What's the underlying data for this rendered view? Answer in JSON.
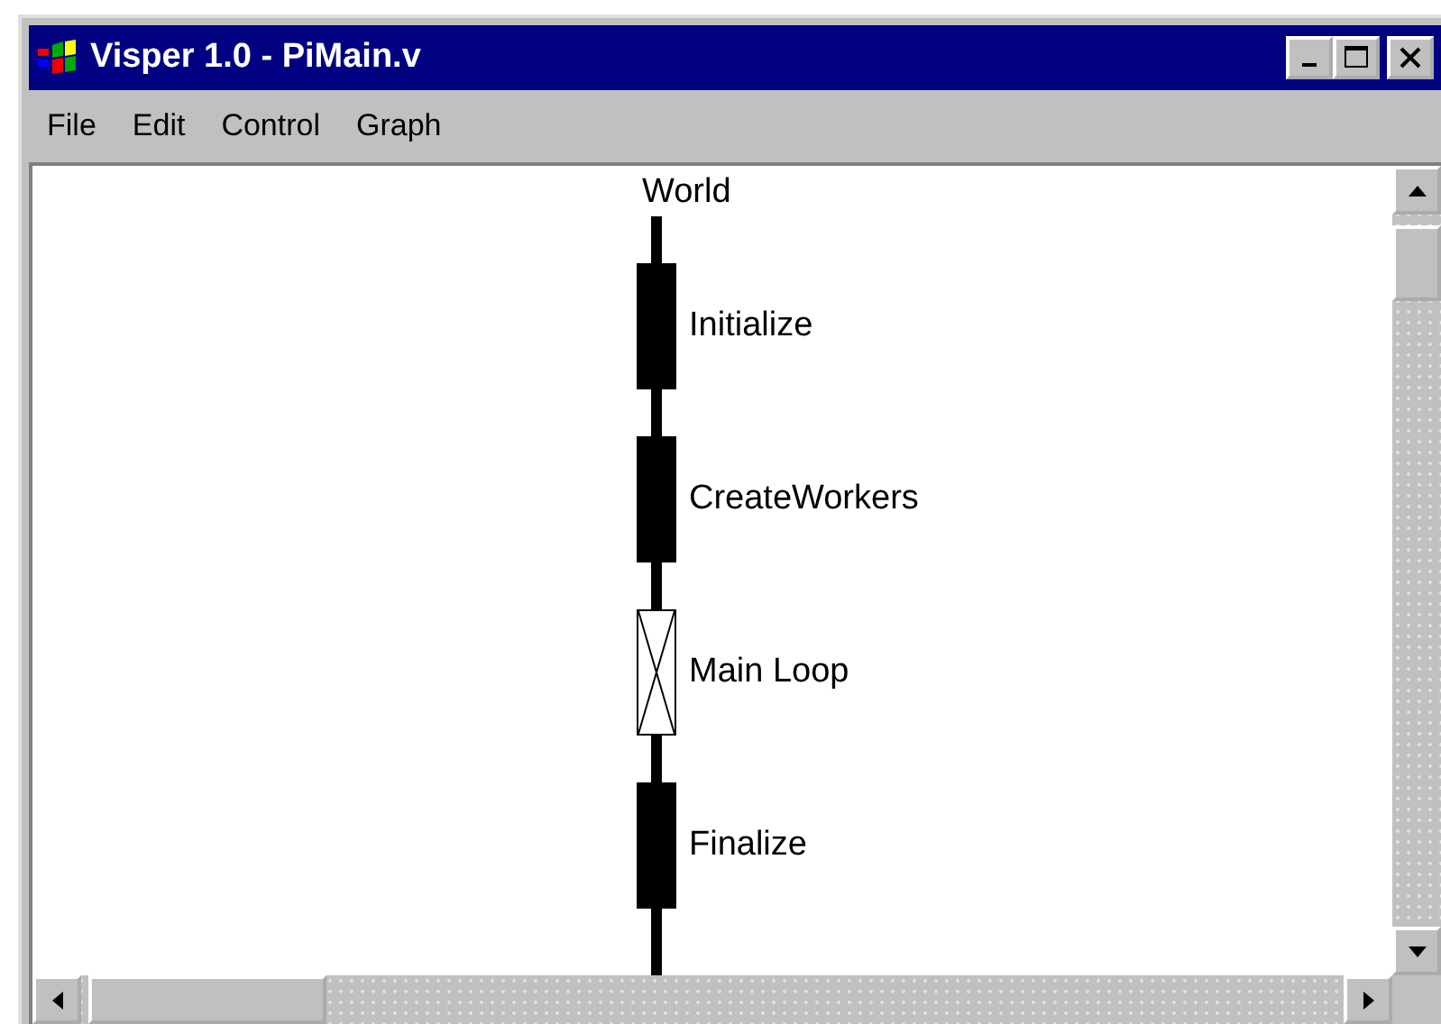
{
  "window": {
    "title": "Visper 1.0 - PiMain.v"
  },
  "menu": [
    "File",
    "Edit",
    "Control",
    "Graph"
  ],
  "graph": {
    "root": "World",
    "nodes": [
      {
        "label": "Initialize",
        "kind": "block"
      },
      {
        "label": "CreateWorkers",
        "kind": "block"
      },
      {
        "label": "Main Loop",
        "kind": "loop"
      },
      {
        "label": "Finalize",
        "kind": "block"
      }
    ]
  }
}
